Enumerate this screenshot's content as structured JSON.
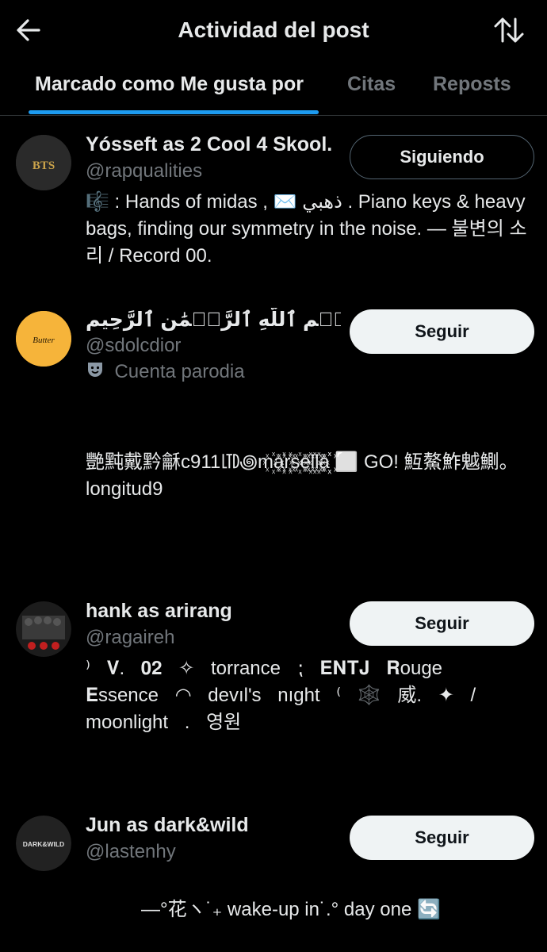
{
  "header": {
    "title": "Actividad del post"
  },
  "tabs": [
    {
      "label": "Marcado como Me gusta por",
      "active": true
    },
    {
      "label": "Citas",
      "active": false
    },
    {
      "label": "Reposts",
      "active": false
    }
  ],
  "users": [
    {
      "name": "Yósseft as 2 Cool 4 Skool.",
      "handle": "@rapqualities",
      "bio": "🎼 : Hands of midas , ✉️ ذهبي . Piano keys & heavy bags, finding our symmetry in the noise. — 불변의 소리 / Record 00.",
      "button": "Siguiendo",
      "avatar_text": "BTS"
    },
    {
      "name": "بِسۡمِ ٱللَّهِ ٱلرَّحۡمَٰنِ ٱلرَّحِيمِ as butt...",
      "handle": "@sdolcdior",
      "parody_label": "Cuenta parodia",
      "bio": "艷黗戴黔龢c911㋏꩜m꙰a꙰r꙰s꙰e꙰l꙰l꙰a꙰꙰꙰ ⬜ GO! 魱鰲鮓魆鰂。longitud9",
      "button": "Seguir",
      "avatar_text": "Butter"
    },
    {
      "name": "hank as arirang",
      "handle": "@ragaireh",
      "bio": "⁾ 𝐕. 𝟎𝟐 ✧ torrance ⁏ 𝐄𝐍𝐓𝐉 𝐑ouge 𝐄ssence ◠ devıl's nıght ⁽ 🕸️ 威. ✦ / moonlight . 영원",
      "button": "Seguir"
    },
    {
      "name": "Jun as dark&wild",
      "handle": "@lastenhy",
      "bio": "—°花ヽ˙₊ wake-up in˙.° day one 🔄",
      "button": "Seguir",
      "avatar_text": "DARK&WILD"
    }
  ],
  "colors": {
    "background": "#000000",
    "primary_text": "#e7e9ea",
    "secondary_text": "#71767b",
    "accent": "#1d9bf0",
    "follow_button_bg": "#eff3f4"
  },
  "icons": {
    "back": "arrow-left-icon",
    "sort": "sort-arrows-icon",
    "parody": "theater-mask-icon"
  }
}
